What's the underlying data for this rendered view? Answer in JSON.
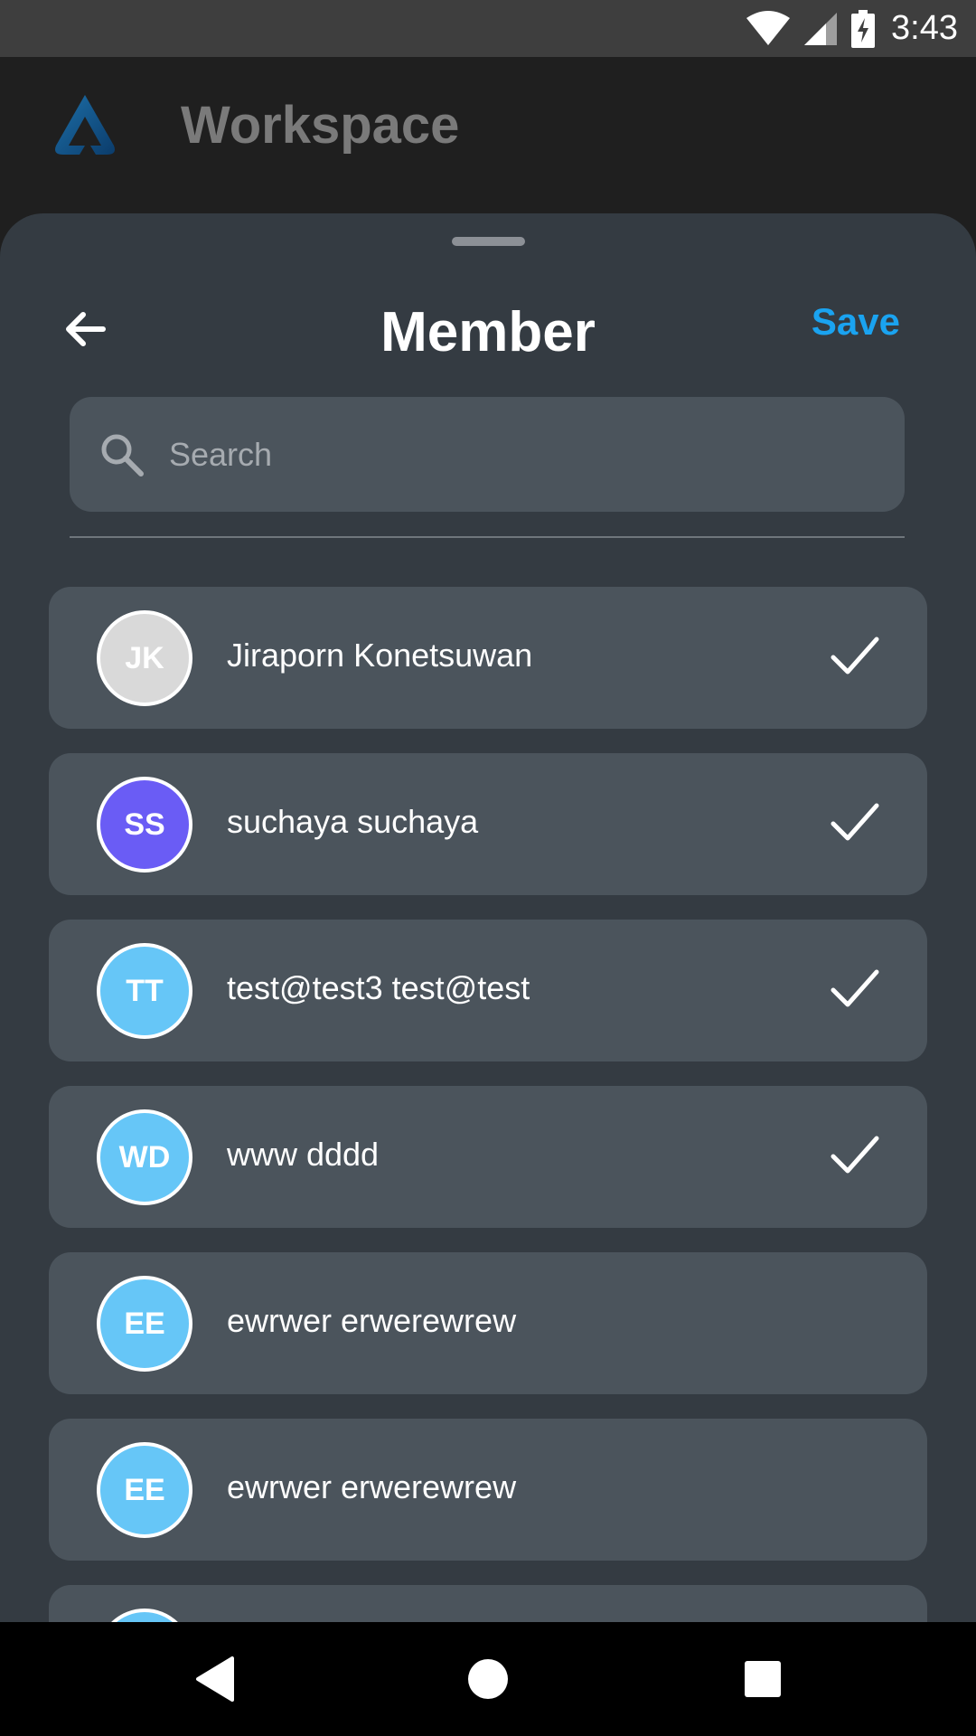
{
  "status_bar": {
    "time": "3:43",
    "icons": [
      "wifi-icon",
      "cell-signal-icon",
      "battery-charging-icon"
    ]
  },
  "app": {
    "title": "Workspace",
    "logo_icon": "workspace-logo-icon"
  },
  "sheet": {
    "title": "Member",
    "back_icon": "arrow-left-icon",
    "save_label": "Save",
    "search": {
      "placeholder": "Search",
      "value": "",
      "icon": "search-icon"
    }
  },
  "members": [
    {
      "initials": "JK",
      "name": "Jiraporn Konetsuwan",
      "selected": true,
      "avatar_color": "#d9d9d9",
      "initials_color": "#ffffff"
    },
    {
      "initials": "SS",
      "name": "suchaya suchaya",
      "selected": true,
      "avatar_color": "#6a5cf5",
      "initials_color": "#ffffff"
    },
    {
      "initials": "TT",
      "name": "test@test3 test@test",
      "selected": true,
      "avatar_color": "#66c6f7",
      "initials_color": "#ffffff"
    },
    {
      "initials": "WD",
      "name": "www dddd",
      "selected": true,
      "avatar_color": "#66c6f7",
      "initials_color": "#ffffff"
    },
    {
      "initials": "EE",
      "name": "ewrwer erwerewrew",
      "selected": false,
      "avatar_color": "#66c6f7",
      "initials_color": "#ffffff"
    },
    {
      "initials": "EE",
      "name": "ewrwer erwerewrew",
      "selected": false,
      "avatar_color": "#66c6f7",
      "initials_color": "#ffffff"
    },
    {
      "initials": "",
      "name": "",
      "selected": false,
      "avatar_color": "#66c6f7",
      "initials_color": "#ffffff"
    }
  ],
  "colors": {
    "accent": "#1aa3f0",
    "sheet_bg": "#343b42",
    "card_bg": "#4b545c"
  },
  "nav_bar": {
    "icons": [
      "nav-back-icon",
      "nav-home-icon",
      "nav-recents-icon"
    ]
  }
}
